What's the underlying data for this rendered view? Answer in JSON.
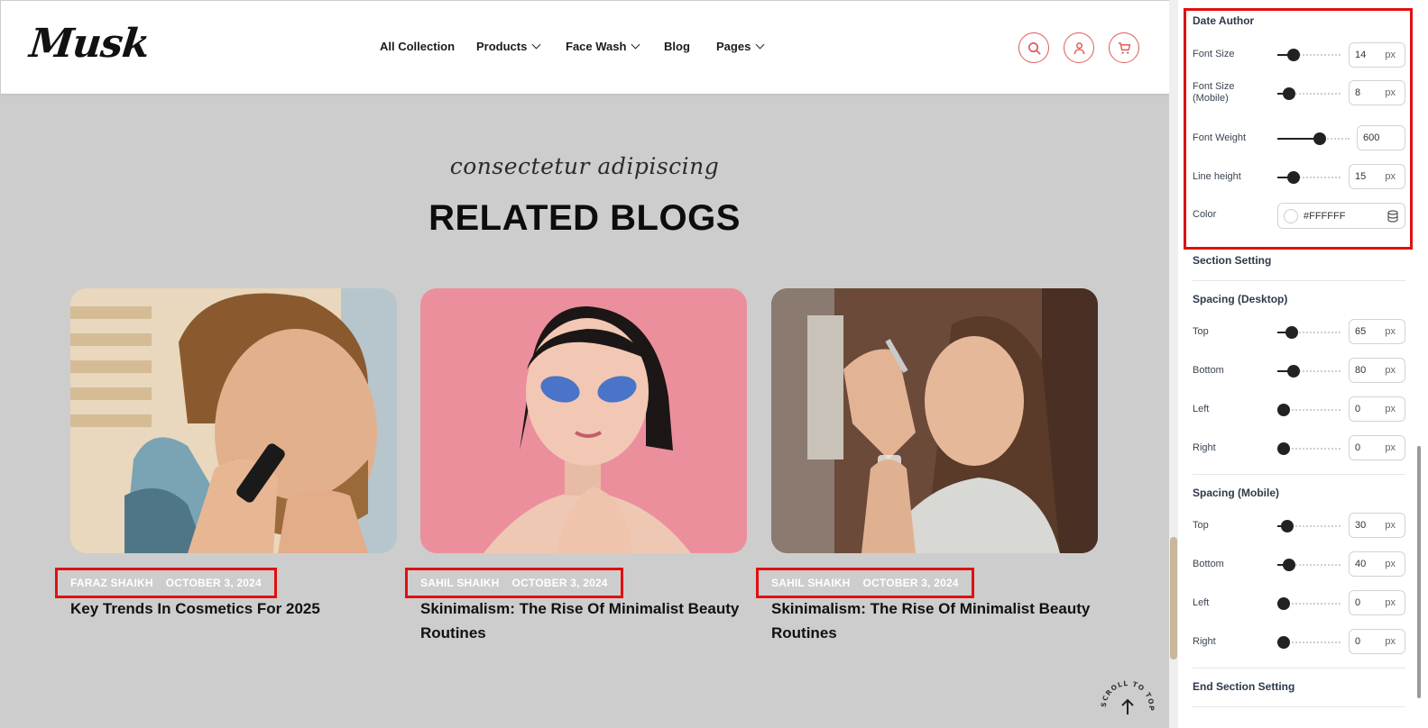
{
  "header": {
    "logo": "Musk",
    "nav": [
      {
        "label": "All Collection",
        "dropdown": false
      },
      {
        "label": "Products",
        "dropdown": true
      },
      {
        "label": "Face Wash",
        "dropdown": true
      },
      {
        "label": "Blog",
        "dropdown": false
      },
      {
        "label": "Pages",
        "dropdown": true
      }
    ],
    "icons": [
      "search-icon",
      "user-icon",
      "cart-icon"
    ],
    "accent": "#e05a5a"
  },
  "section": {
    "subtitle": "consectetur adipiscing",
    "title": "RELATED BLOGS",
    "cards": [
      {
        "author": "FARAZ SHAIKH",
        "date": "OCTOBER 3, 2024",
        "title": "Key Trends In Cosmetics For 2025",
        "image": "man-trimming-beard-photo"
      },
      {
        "author": "SAHIL SHAIKH",
        "date": "OCTOBER 3, 2024",
        "title": "Skinimalism: The Rise Of Minimalist Beauty Routines",
        "image": "woman-eye-patches-photo"
      },
      {
        "author": "SAHIL SHAIKH",
        "date": "OCTOBER 3, 2024",
        "title": "Skinimalism: The Rise Of Minimalist Beauty Routines",
        "image": "woman-serum-dropper-photo"
      }
    ],
    "scroll_to_top": "SCROLL TO TOP"
  },
  "panel": {
    "date_author": {
      "title": "Date Author",
      "font_size": {
        "label": "Font Size",
        "value": "14",
        "unit": "px",
        "level": 0.2
      },
      "font_size_mobile": {
        "label": "Font Size (Mobile)",
        "value": "8",
        "unit": "px",
        "level": 0.1
      },
      "font_weight": {
        "label": "Font Weight",
        "value": "600",
        "level": 0.6
      },
      "line_height": {
        "label": "Line height",
        "value": "15",
        "unit": "px",
        "level": 0.2
      },
      "color": {
        "label": "Color",
        "value": "#FFFFFF"
      }
    },
    "section_setting": "Section Setting",
    "spacing_desktop": {
      "title": "Spacing (Desktop)",
      "rows": [
        {
          "label": "Top",
          "value": "65",
          "unit": "px",
          "level": 0.16
        },
        {
          "label": "Bottom",
          "value": "80",
          "unit": "px",
          "level": 0.2
        },
        {
          "label": "Left",
          "value": "0",
          "unit": "px",
          "level": 0
        },
        {
          "label": "Right",
          "value": "0",
          "unit": "px",
          "level": 0
        }
      ]
    },
    "spacing_mobile": {
      "title": "Spacing (Mobile)",
      "rows": [
        {
          "label": "Top",
          "value": "30",
          "unit": "px",
          "level": 0.07
        },
        {
          "label": "Bottom",
          "value": "40",
          "unit": "px",
          "level": 0.1
        },
        {
          "label": "Left",
          "value": "0",
          "unit": "px",
          "level": 0
        },
        {
          "label": "Right",
          "value": "0",
          "unit": "px",
          "level": 0
        }
      ]
    },
    "end_section_setting": "End Section Setting",
    "highlight_color": "#e01010"
  }
}
